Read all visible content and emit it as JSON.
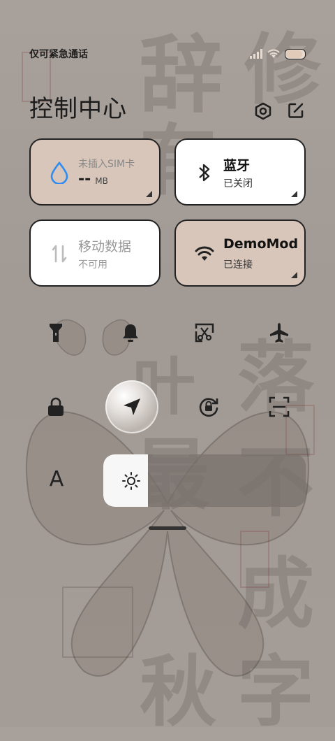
{
  "status": {
    "carrier": "仅可紧急通话",
    "battery_level": 0.9
  },
  "header": {
    "title": "控制中心"
  },
  "tiles": {
    "data_usage": {
      "label": "未插入SIM卡",
      "value": "--",
      "unit": "MB"
    },
    "bluetooth": {
      "label": "蓝牙",
      "status": "已关闭"
    },
    "mobile_data": {
      "label": "移动数据",
      "status": "不可用"
    },
    "wifi": {
      "label": "DemoMode",
      "status": "已连接"
    }
  },
  "toggles_row1": [
    "flashlight-icon",
    "bell-icon",
    "screenshot-icon",
    "airplane-icon"
  ],
  "toggles_row2": [
    "lock-icon",
    "location-icon",
    "rotation-lock-icon",
    "scan-icon"
  ],
  "brightness": {
    "font_label": "A",
    "level": 0.22
  },
  "colors": {
    "tile_active": "#d8c6ba",
    "tile_inactive": "#ffffff",
    "accent_blue": "#2f8cf0"
  }
}
